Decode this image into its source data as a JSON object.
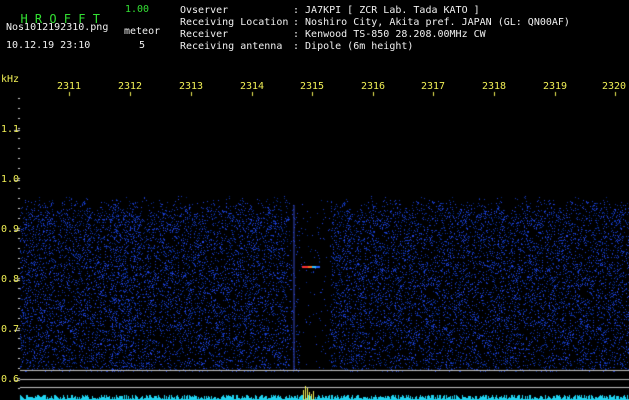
{
  "app": {
    "name": "H R O F F T",
    "version": "1.00",
    "filename": "Nos1012192310.png",
    "datetime": "10.12.19 23:10",
    "meteor_label": "meteor",
    "meteor_count": "5"
  },
  "info": {
    "labels": [
      "Ovserver",
      "Receiving Location",
      "Receiver",
      "Receiving antenna"
    ],
    "values": [
      ": JA7KPI [ ZCR Lab. Tada KATO ]",
      ": Noshiro City, Akita pref. JAPAN (GL: QN00AF)",
      ": Kenwood TS-850 28.208.00MHz CW",
      ": Dipole (6m height)"
    ]
  },
  "axis": {
    "unit_label": "kHz",
    "time_labels": [
      "2311",
      "2312",
      "2313",
      "2314",
      "2315",
      "2316",
      "2317",
      "2318",
      "2319",
      "2320"
    ],
    "freq_labels": [
      "1.1",
      "1.0",
      "0.9",
      "0.8",
      "0.7",
      "0.6"
    ]
  },
  "colors": {
    "background": "#000000",
    "text": "#f0f0f0",
    "title_green": "#33e033",
    "axis_yellow": "#f0ef55",
    "noise_blue": "#2a3fd0",
    "signal_red": "#ff3030",
    "meter_cyan": "#1fd3f0"
  },
  "chart_data": {
    "type": "heatmap",
    "x_label": "",
    "y_label": "kHz",
    "x_ticks": [
      "2311",
      "2312",
      "2313",
      "2314",
      "2315",
      "2316",
      "2317",
      "2318",
      "2319",
      "2320"
    ],
    "y_ticks": [
      "1.1",
      "1.0",
      "0.9",
      "0.8",
      "0.7",
      "0.6"
    ],
    "annotations": [
      {
        "label": "meteor echo",
        "time": "2315",
        "freq_khz": 0.82
      }
    ]
  }
}
